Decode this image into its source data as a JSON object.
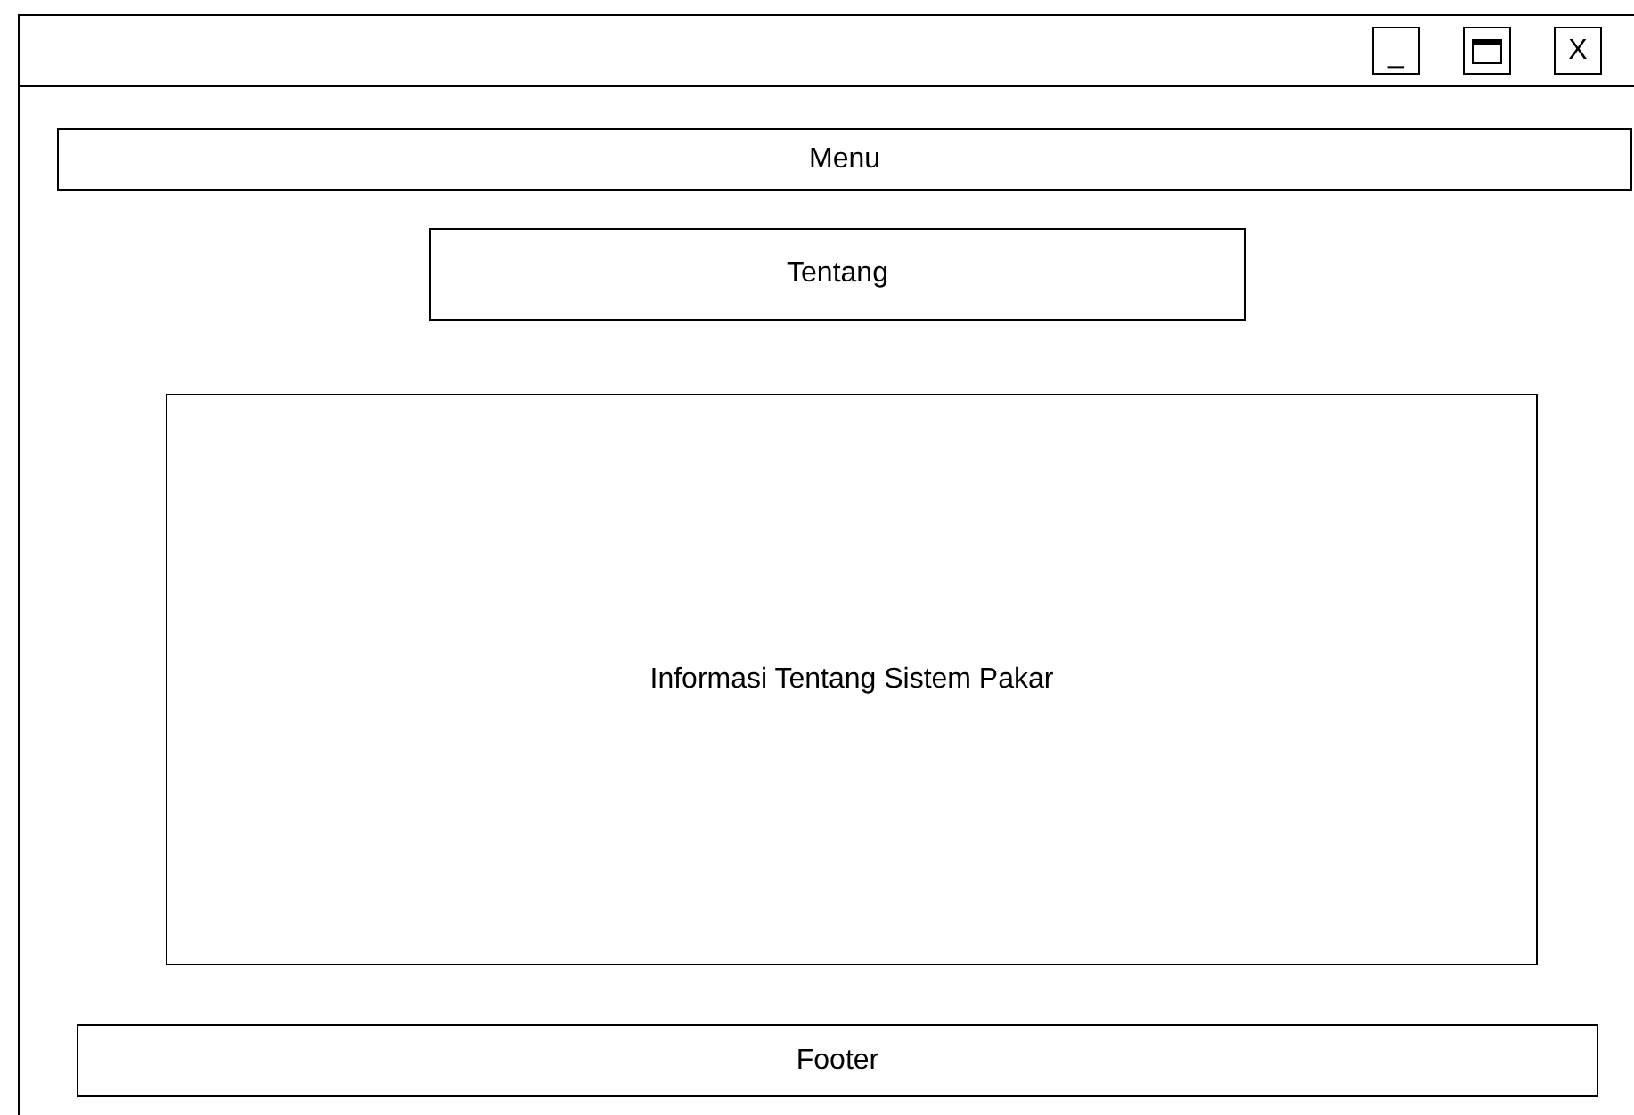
{
  "window": {
    "buttons": [
      {
        "kind": "minimize",
        "label": "_"
      },
      {
        "kind": "maximize"
      },
      {
        "kind": "close",
        "label": "X"
      }
    ]
  },
  "menu": {
    "label": "Menu"
  },
  "heading": {
    "label": "Tentang"
  },
  "content": {
    "text": "Informasi Tentang Sistem Pakar"
  },
  "footer": {
    "label": "Footer"
  }
}
